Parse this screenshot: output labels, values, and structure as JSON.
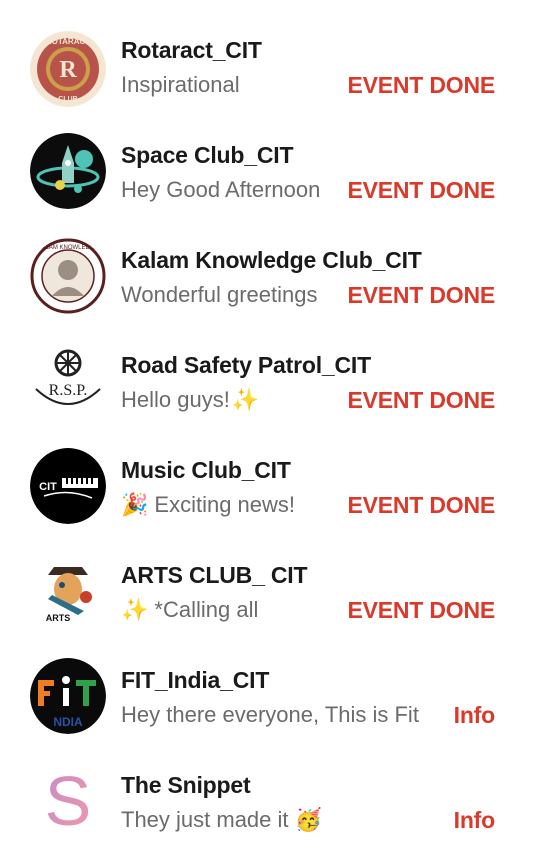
{
  "chats": [
    {
      "name": "Rotaract_CIT",
      "preview": "Inspirational",
      "status": "EVENT DONE",
      "avatar_icon": "rotaract-club-logo-icon",
      "avatar_text": "R"
    },
    {
      "name": "Space Club_CIT",
      "preview": "Hey Good Afternoon",
      "status": "EVENT DONE",
      "avatar_icon": "space-club-logo-icon"
    },
    {
      "name": "Kalam Knowledge Club_CIT",
      "preview": "Wonderful greetings",
      "status": "EVENT DONE",
      "avatar_icon": "kalam-knowledge-club-logo-icon"
    },
    {
      "name": "Road Safety Patrol_CIT",
      "preview": "Hello guys!",
      "preview_emoji": "✨",
      "status": "EVENT DONE",
      "avatar_icon": "road-safety-patrol-logo-icon",
      "avatar_text": "R.S.P."
    },
    {
      "name": "Music Club_CIT",
      "preview_emoji": "🎉",
      "preview": "Exciting news!",
      "status": "EVENT DONE",
      "avatar_icon": "music-club-logo-icon",
      "avatar_text": "CIT"
    },
    {
      "name": "ARTS CLUB_ CIT",
      "preview_emoji": "✨",
      "preview": "*Calling all",
      "status": "EVENT DONE",
      "avatar_icon": "arts-club-logo-icon",
      "avatar_text": "ARTS"
    },
    {
      "name": "FIT_India_CIT",
      "preview": "Hey there everyone, This is Fit",
      "status": "Info",
      "avatar_icon": "fit-india-logo-icon",
      "avatar_text": "FIT"
    },
    {
      "name": "The Snippet",
      "preview": "They just made it",
      "preview_emoji": "🥳",
      "status": "Info",
      "avatar_icon": "snippet-logo-icon",
      "avatar_text": "S"
    }
  ],
  "colors": {
    "status_red": "#d93a2b",
    "title": "#1a1a1a",
    "preview": "#6b6b6b"
  }
}
